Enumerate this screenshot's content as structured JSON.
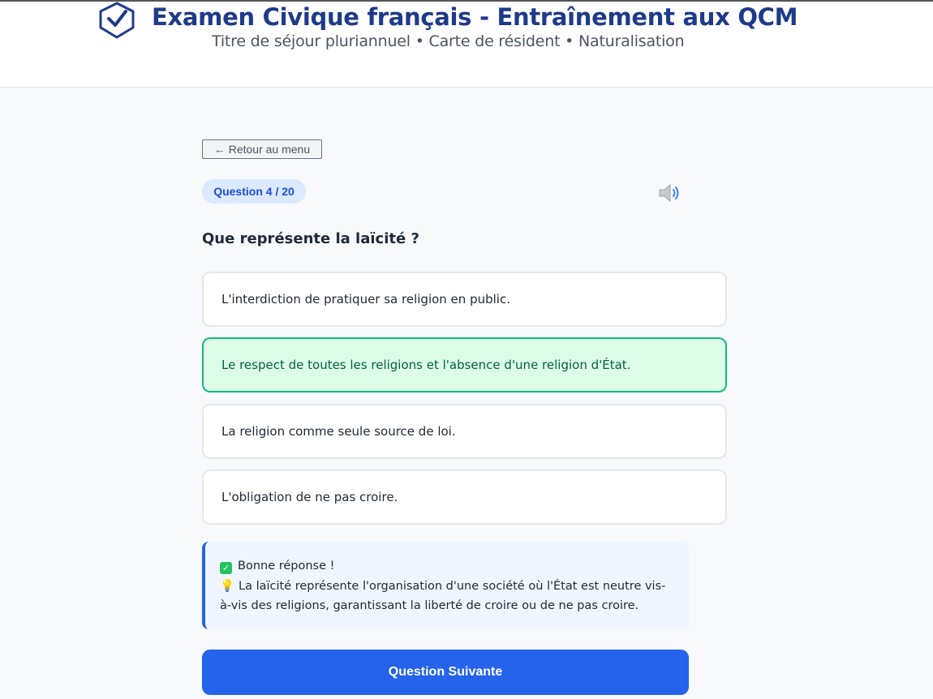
{
  "header": {
    "title": "Examen Civique français - Entraînement aux QCM",
    "subtitle": "Titre de séjour pluriannuel • Carte de résident • Naturalisation",
    "logo_icon": "shield-check-icon"
  },
  "nav": {
    "back_label": "← Retour au menu"
  },
  "quiz": {
    "progress_label": "Question 4 / 20",
    "audio_icon": "speaker-icon",
    "question": "Que représente la laïcité ?",
    "options": [
      "L'interdiction de pratiquer sa religion en public.",
      "Le respect de toutes les religions et l'absence d'une religion d'État.",
      "La religion comme seule source de loi.",
      "L'obligation de ne pas croire."
    ],
    "selected_option": 2
  },
  "feedback": {
    "status_icon": "check-mark-icon",
    "status": "Bonne réponse !",
    "explanation_icon": "light-bulb-icon",
    "explanation": "La laïcité représente l'organisation d'une société où l'État est neutre vis-à-vis des religions, garantissant la liberté de croire ou de ne pas croire."
  },
  "actions": {
    "next_label": "Question Suivante"
  },
  "colors": {
    "brand": "#1e3a8a",
    "accent": "#2563eb",
    "correct_bg": "#dcfce7",
    "correct_border": "#10b981"
  }
}
